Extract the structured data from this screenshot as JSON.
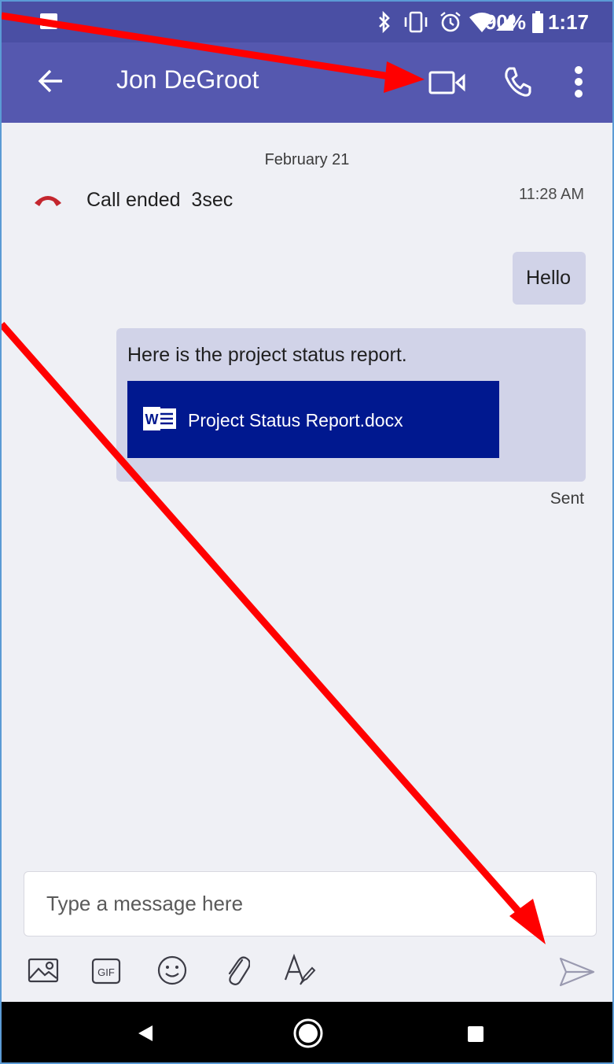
{
  "status_bar": {
    "battery_percent": "90%",
    "time": "1:17",
    "icons": [
      "gallery-notification-icon",
      "bluetooth-icon",
      "vibrate-icon",
      "alarm-icon",
      "wifi-icon",
      "signal-icon",
      "battery-icon"
    ]
  },
  "header": {
    "back_icon": "arrow-left-icon",
    "contact_name": "Jon DeGroot",
    "actions": [
      "video-call-icon",
      "phone-icon",
      "more-vertical-icon"
    ]
  },
  "conversation": {
    "date": "February 21",
    "call_event": {
      "icon": "call-ended-icon",
      "text": "Call ended  3sec",
      "time": "11:28 AM"
    },
    "messages": [
      {
        "text": "Hello"
      },
      {
        "text": "Here is the project status report.",
        "attachment": {
          "icon": "word-doc-icon",
          "name": "Project Status Report.docx"
        }
      }
    ],
    "delivery_status": "Sent"
  },
  "composer": {
    "placeholder": "Type a message here",
    "value": "",
    "tools": [
      "image-icon",
      "gif-icon",
      "emoji-icon",
      "attach-icon",
      "format-icon"
    ],
    "send_icon": "send-icon"
  },
  "nav_bar": {
    "buttons": [
      "back-triangle-icon",
      "home-circle-icon",
      "recents-square-icon"
    ]
  },
  "colors": {
    "status_bar": "#4a4fa4",
    "app_bar": "#5558af",
    "chat_background": "#eff0f5",
    "bubble": "#d1d3e8",
    "attachment": "#00188f",
    "call_ended_red": "#c4262e",
    "annotation_arrow": "#ff0000"
  }
}
